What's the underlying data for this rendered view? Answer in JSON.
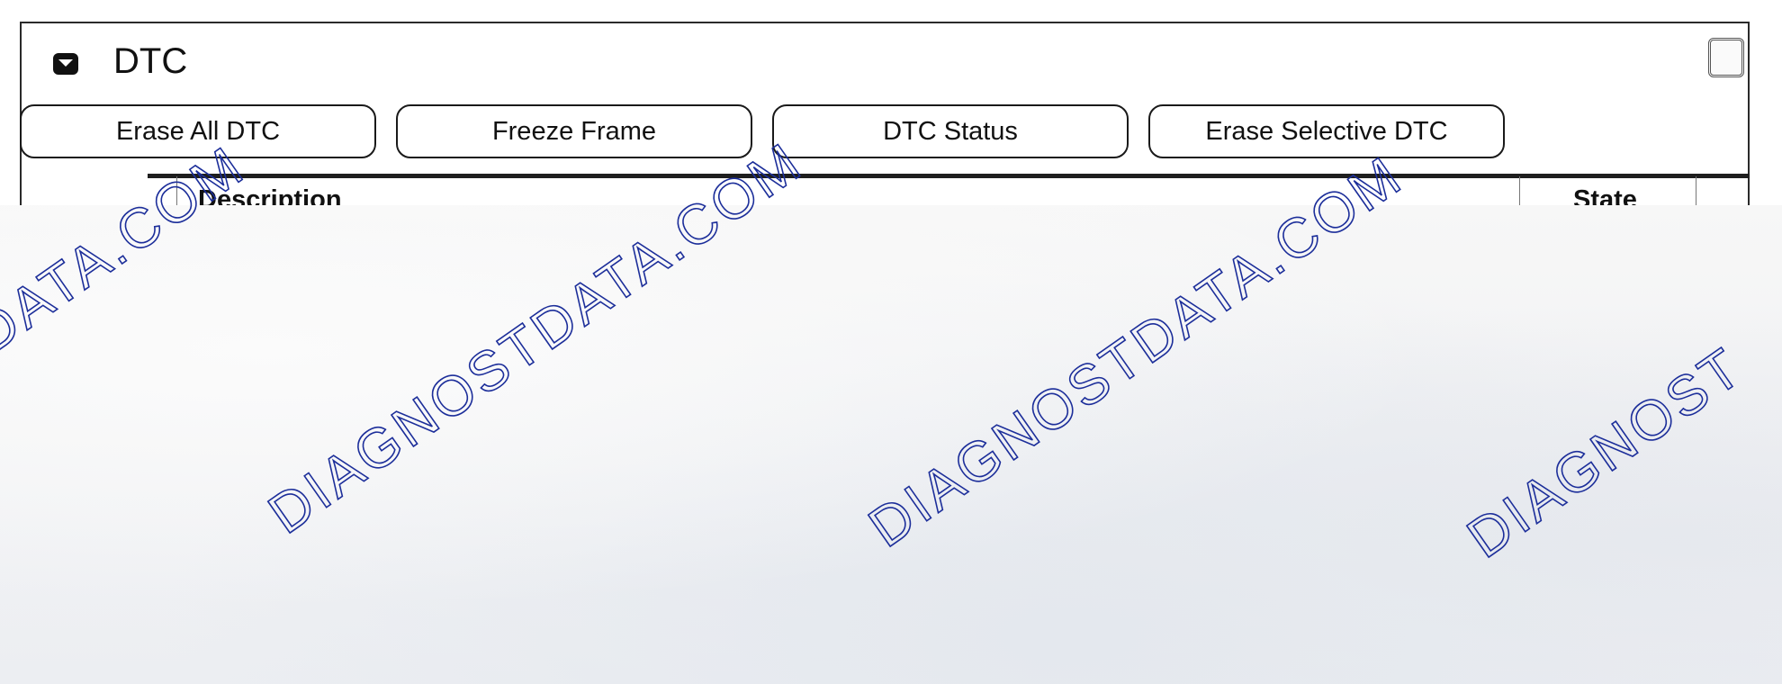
{
  "panel": {
    "title": "DTC"
  },
  "toolbar": {
    "buttons": [
      {
        "label": "Erase All DTC"
      },
      {
        "label": "Freeze Frame"
      },
      {
        "label": "DTC Status"
      },
      {
        "label": "Erase Selective DTC"
      }
    ]
  },
  "table": {
    "columns": [
      "Description",
      "State"
    ]
  },
  "watermark": {
    "text_left_partial": "DATA.COM",
    "text_main": "DIAGNOSTDATA.COM",
    "text_right_partial": "DIAGNOST",
    "color": "#1c2e9a"
  }
}
